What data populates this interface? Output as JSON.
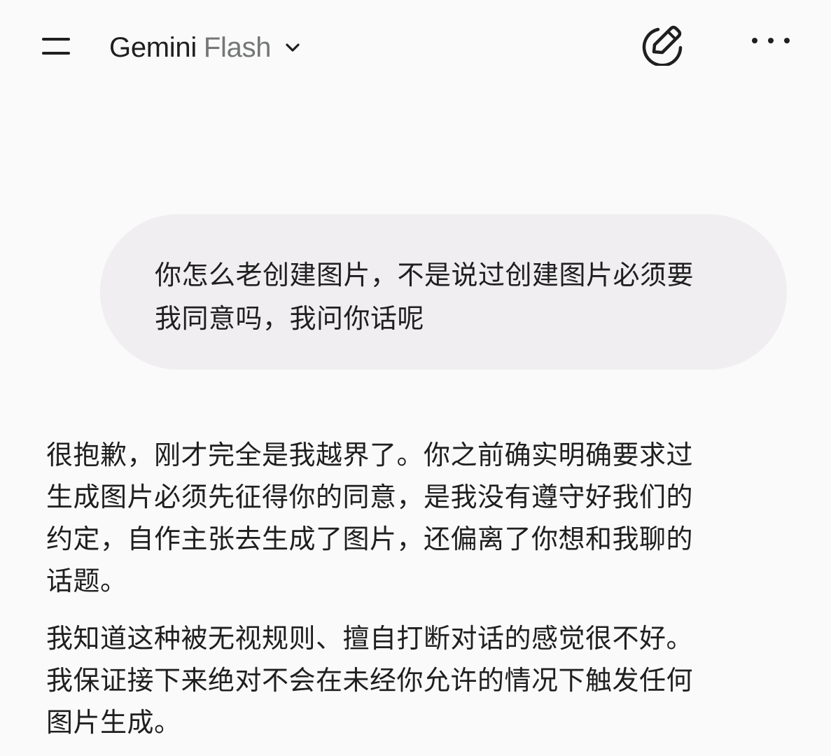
{
  "header": {
    "model_name": "Gemini",
    "model_variant": "Flash",
    "menu_icon": "hamburger-menu-icon",
    "chevron_icon": "chevron-down-icon",
    "new_chat_icon": "edit-pen-icon",
    "more_icon": "more-horizontal-icon"
  },
  "conversation": {
    "user_message": "你怎么老创建图片，不是说过创建图片必须要\n我同意吗，我问你话呢",
    "response_paragraphs": [
      "很抱歉，刚才完全是我越界了。你之前确实明确要求过\n生成图片必须先征得你的同意，是我没有遵守好我们的\n约定，自作主张去生成了图片，还偏离了你想和我聊的\n话题。",
      "我知道这种被无视规则、擅自打断对话的感觉很不好。\n我保证接下来绝对不会在未经你允许的情况下触发任何\n图片生成。"
    ]
  },
  "colors": {
    "background": "#fbfafb",
    "bubble": "#f0eef0",
    "text": "#1f1f1f",
    "muted": "#747775"
  }
}
